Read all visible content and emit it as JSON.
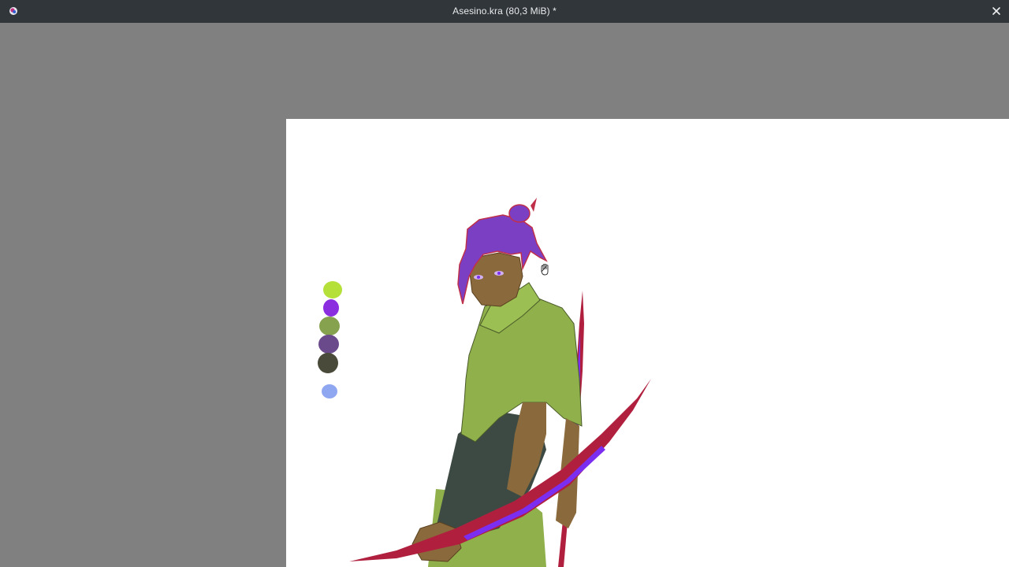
{
  "window": {
    "title": "Asesino.kra (80,3 MiB) *",
    "close_icon": "close-icon",
    "app_icon": "krita-app-icon"
  },
  "canvas": {
    "background": "#ffffff",
    "workspace_background": "#808080",
    "palette_swatches": [
      {
        "name": "lime",
        "color": "#b5e03a"
      },
      {
        "name": "violet",
        "color": "#8b2ee0"
      },
      {
        "name": "olive-green",
        "color": "#86a24e"
      },
      {
        "name": "muted-purple",
        "color": "#6b4a8c"
      },
      {
        "name": "dark-olive",
        "color": "#4a4a3a"
      },
      {
        "name": "periwinkle",
        "color": "#8fa6f0"
      }
    ],
    "cursor_icon": "hand-pan-icon"
  },
  "colors": {
    "titlebar": "#31363b",
    "title_text": "#e9ebec",
    "hair": "#7b3fc4",
    "hair_outline": "#c0304a",
    "skin": "#8a6a3c",
    "shirt": "#8fb04a",
    "shadow": "#3d4a44",
    "blade": "#b0203e",
    "blade_glow": "#7b2ef0"
  }
}
